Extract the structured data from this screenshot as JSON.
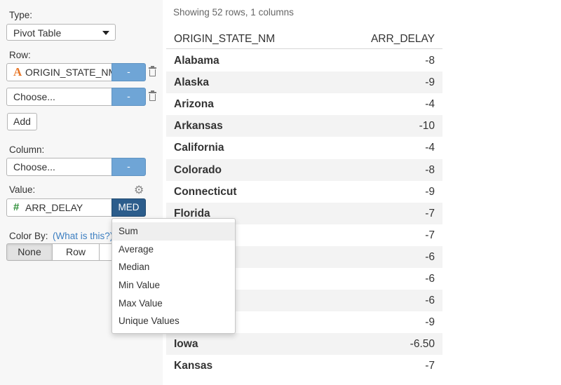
{
  "left_panel": {
    "type_label": "Type:",
    "type_value": "Pivot Table",
    "row_label": "Row:",
    "row_field_1": "ORIGIN_STATE_NM",
    "row_field_1_type_icon": "A",
    "row_field_1_button": "-",
    "row_field_2": "Choose...",
    "row_field_2_button": "-",
    "add_button": "Add",
    "column_label": "Column:",
    "column_field": "Choose...",
    "column_button": "-",
    "value_label": "Value:",
    "value_field": "ARR_DELAY",
    "value_type_icon": "#",
    "value_agg_button": "MED",
    "color_by_label": "Color By:",
    "what_is_this_link": "(What is this?)",
    "color_by_options": [
      "None",
      "Row"
    ],
    "icons": {
      "trash": "trash-icon",
      "gear": "gear-icon",
      "caret": "caret-down-icon"
    }
  },
  "table": {
    "row_count_text": "Showing 52 rows, 1 columns",
    "headers": [
      "ORIGIN_STATE_NM",
      "ARR_DELAY"
    ],
    "rows": [
      {
        "state": "Alabama",
        "value": "-8"
      },
      {
        "state": "Alaska",
        "value": "-9"
      },
      {
        "state": "Arizona",
        "value": "-4"
      },
      {
        "state": "Arkansas",
        "value": "-10"
      },
      {
        "state": "California",
        "value": "-4"
      },
      {
        "state": "Colorado",
        "value": "-8"
      },
      {
        "state": "Connecticut",
        "value": "-9"
      },
      {
        "state": "Florida",
        "value": "-7"
      },
      {
        "state": "",
        "value": "-7"
      },
      {
        "state": "",
        "value": "-6"
      },
      {
        "state": "",
        "value": "-6"
      },
      {
        "state": "",
        "value": "-6"
      },
      {
        "state": "",
        "value": "-9"
      },
      {
        "state": "Iowa",
        "value": "-6.50"
      },
      {
        "state": "Kansas",
        "value": "-7"
      }
    ]
  },
  "agg_menu": {
    "items": [
      "Sum",
      "Average",
      "Median",
      "Min Value",
      "Max Value",
      "Unique Values"
    ],
    "highlighted": "Sum"
  },
  "colors": {
    "accent_blue": "#6fa5d6",
    "active_blue": "#2c5d8c",
    "string_type": "#e8782a",
    "number_type": "#2f8f39",
    "link": "#3d7fc1"
  }
}
